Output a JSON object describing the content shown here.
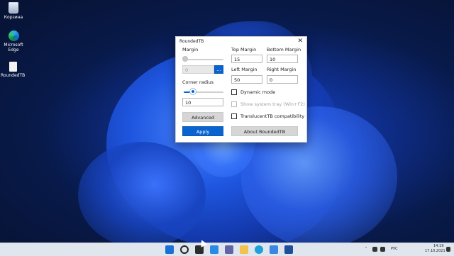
{
  "desktop": {
    "icons": [
      {
        "label": "Корзина"
      },
      {
        "label": "Microsoft Edge"
      },
      {
        "label": "RoundedTB"
      }
    ]
  },
  "window": {
    "title": "RoundedTB",
    "close_glyph": "✕",
    "left": {
      "margin_label": "Margin",
      "margin_value": "0",
      "dots_label": "...",
      "corner_radius_label": "Corner radius",
      "corner_radius_value": "10",
      "advanced_label": "Advanced",
      "apply_label": "Apply"
    },
    "right": {
      "top_margin_label": "Top Margin",
      "top_margin_value": "15",
      "bottom_margin_label": "Bottom Margin",
      "bottom_margin_value": "10",
      "left_margin_label": "Left Margin",
      "left_margin_value": "50",
      "right_margin_label": "Right Margin",
      "right_margin_value": "0",
      "dynamic_mode_label": "Dynamic mode",
      "show_tray_label": "Show system tray (Win+F2)",
      "translucent_label": "TranslucentTB compatibility",
      "about_label": "About RoundedTB"
    }
  },
  "taskbar": {
    "lang": "РУС",
    "time": "14:19",
    "date": "17.10.2021"
  },
  "colors": {
    "accent": "#0a64d0"
  }
}
